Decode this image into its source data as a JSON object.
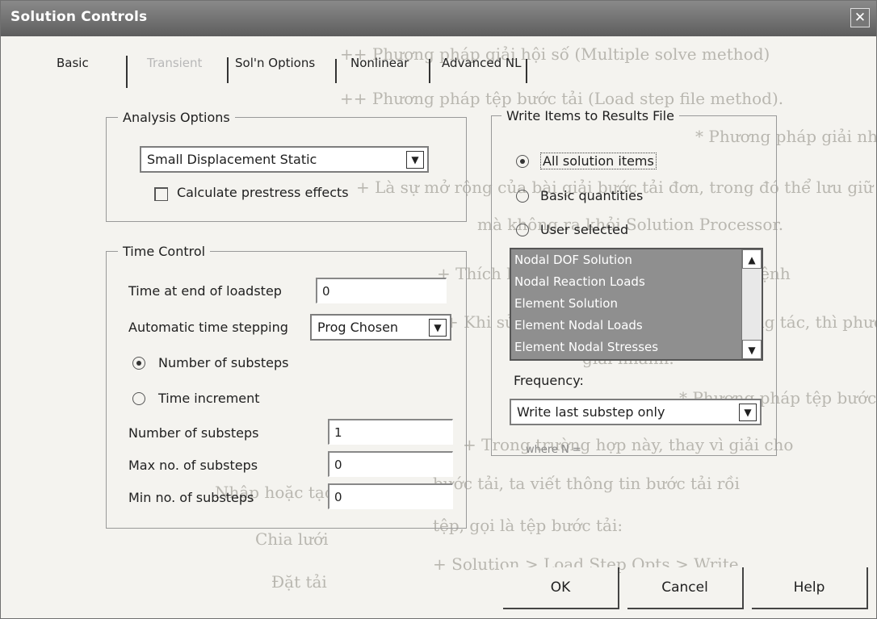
{
  "window": {
    "title": "Solution Controls",
    "close_symbol": "✕"
  },
  "tabs": [
    {
      "label": "Basic",
      "enabled": true
    },
    {
      "label": "Transient",
      "enabled": false
    },
    {
      "label": "Sol'n Options",
      "enabled": true
    },
    {
      "label": "Nonlinear",
      "enabled": true
    },
    {
      "label": "Advanced NL",
      "enabled": true
    }
  ],
  "analysis_options": {
    "legend": "Analysis Options",
    "type_value": "Small Displacement Static",
    "prestress_label": "Calculate prestress effects"
  },
  "time_control": {
    "legend": "Time Control",
    "end_label": "Time at end of loadstep",
    "end_value": "0",
    "auto_label": "Automatic time stepping",
    "auto_value": "Prog Chosen",
    "radio_substeps": "Number of substeps",
    "radio_increment": "Time increment",
    "num_label": "Number of substeps",
    "num_value": "1",
    "max_label": "Max no. of substeps",
    "max_value": "0",
    "min_label": "Min no. of substeps",
    "min_value": "0"
  },
  "write_items": {
    "legend": "Write Items to Results File",
    "all_label": "All solution items",
    "basic_label": "Basic quantities",
    "user_label": "User selected",
    "list": [
      "Nodal DOF Solution",
      "Nodal Reaction Loads",
      "Element Solution",
      "Element Nodal Loads",
      "Element Nodal Stresses"
    ],
    "frequency_label": "Frequency:",
    "frequency_value": "Write last substep only",
    "where_text": "where N ="
  },
  "buttons": {
    "ok": "OK",
    "cancel": "Cancel",
    "help": "Help"
  },
  "background_text": [
    "++ Phương pháp giải hội số (Multiple solve method)",
    "++ Phương pháp tệp bước tải (Load step file method).",
    "* Phương pháp giải nhiều bước",
    "+ Là sự mở rộng của bài giải bước tải đơn, trong đó thể lưu giữ từng bước tiếp từng bước",
    "mà không ra khỏi Solution Processor.",
    "+ Thích hợp nhất cho chương trình gỗ lệnh",
    "+ Khi sử dụng trong chương trình tương tác, thì phương pháp này chỉ tốt cho các mô",
    "giải nhanh.",
    "* Phương pháp tệp bước tải",
    "+ Trong trường hợp này, thay vì giải cho",
    "bước tải, ta viết thông tin bước tải rồi",
    "tệp, gọi là tệp bước tải:",
    "+ Solution > Load Step Opts > Write",
    "Nhập hoặc tạo mô hình học",
    "Chia lưới",
    "Đặt tải"
  ]
}
